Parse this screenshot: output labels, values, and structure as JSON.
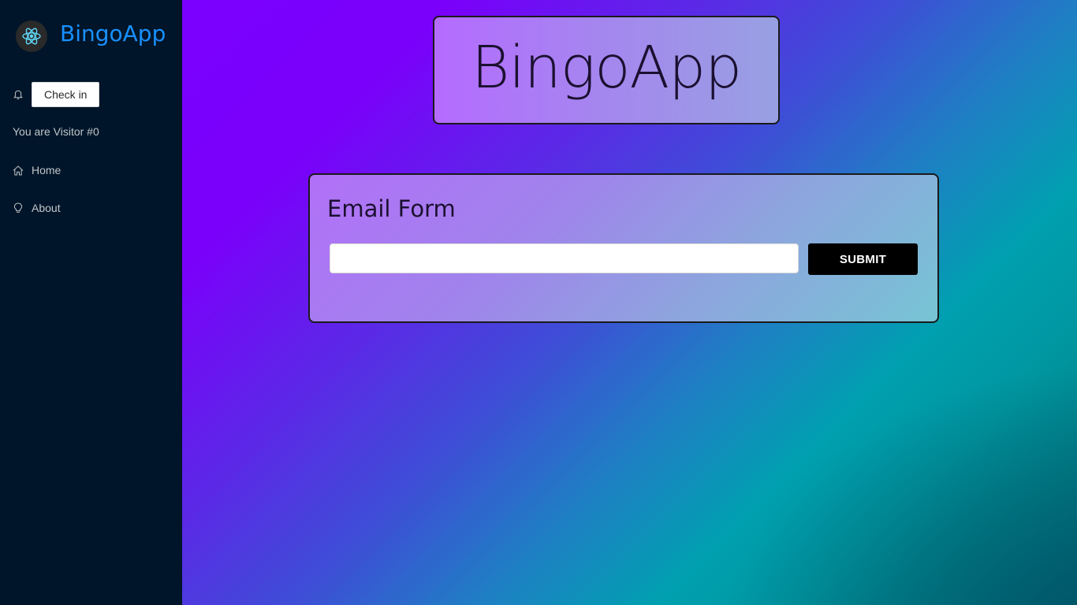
{
  "sidebar": {
    "brand_name": "BingoApp",
    "logo_icon": "atom-icon",
    "checkin_label": "Check in",
    "bell_icon": "bell-icon",
    "visitor_text": "You are Visitor #0",
    "menu": [
      {
        "label": "Home",
        "icon": "home-icon"
      },
      {
        "label": "About",
        "icon": "bulb-icon"
      }
    ]
  },
  "main": {
    "title": "BingoApp",
    "form": {
      "title": "Email Form",
      "email_value": "",
      "email_placeholder": "",
      "submit_label": "SUBMIT"
    }
  },
  "colors": {
    "sidebar_bg": "#001529",
    "brand": "#1890ff",
    "gradient_start": "#7b00ff",
    "gradient_end": "#00a0b0"
  }
}
